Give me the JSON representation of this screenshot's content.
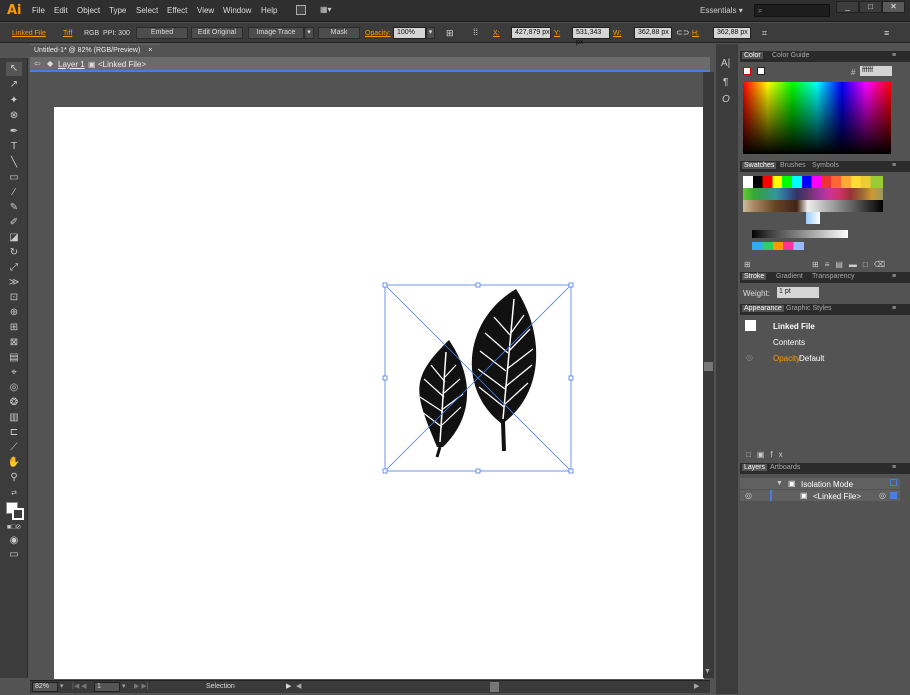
{
  "app": {
    "logo": "Ai",
    "window_buttons": [
      "_",
      "□",
      "✕"
    ]
  },
  "menu": [
    "File",
    "Edit",
    "Object",
    "Type",
    "Select",
    "Effect",
    "View",
    "Window",
    "Help"
  ],
  "workspace": "Essentials",
  "control": {
    "linked_file": "Linked File",
    "file_type": "Tiff",
    "color_mode": "RGB",
    "ppi": "PPI: 300",
    "embed": "Embed",
    "edit_original": "Edit Original",
    "image_trace": "Image Trace",
    "mask": "Mask",
    "opacity_label": "Opacity:",
    "opacity_value": "100%",
    "x_label": "X:",
    "x_value": "427,879 px",
    "y_label": "Y:",
    "y_value": "531,343 px",
    "w_label": "W:",
    "w_value": "362,88 px",
    "h_label": "H:",
    "h_value": "362,88 px"
  },
  "document": {
    "tab_title": "Untitled-1* @ 82% (RGB/Preview)",
    "close": "×"
  },
  "isolation": {
    "layer": "Layer 1",
    "object": "<Linked File>"
  },
  "status": {
    "zoom": "82%",
    "page": "1",
    "tool": "Selection"
  },
  "color_panel": {
    "tabs": [
      "Color",
      "Color Guide"
    ],
    "hex_label": "#",
    "hex": "ffffff"
  },
  "swatches_panel": {
    "tabs": [
      "Swatches",
      "Brushes",
      "Symbols"
    ]
  },
  "stroke_panel": {
    "tabs": [
      "Stroke",
      "Gradient",
      "Transparency"
    ],
    "weight_label": "Weight:",
    "weight_value": "1 pt"
  },
  "appearance_panel": {
    "tabs": [
      "Appearance",
      "Graphic Styles"
    ],
    "item": "Linked File",
    "contents": "Contents",
    "opacity_label": "Opacity:",
    "opacity_value": "Default"
  },
  "layers_panel": {
    "tabs": [
      "Layers",
      "Artboards"
    ],
    "rows": [
      "Isolation Mode",
      "<Linked File>"
    ]
  },
  "side_icons": [
    "A|",
    "¶",
    "O"
  ],
  "colors": {
    "accent": "#ff9a00",
    "selection": "#4a7ce8"
  }
}
